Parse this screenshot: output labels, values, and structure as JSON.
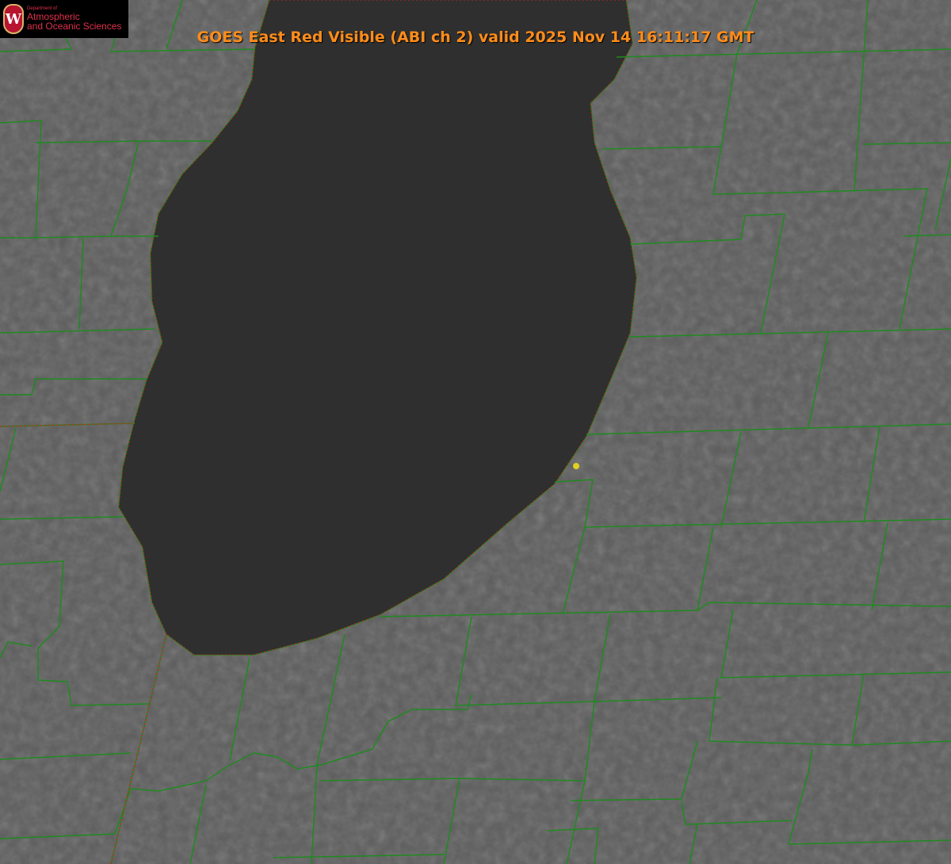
{
  "title": "GOES East Red Visible (ABI ch 2) valid 2025 Nov 14 16:11:17 GMT",
  "logo": {
    "dept": "Department of",
    "line1": "Atmospheric",
    "line2": "and Oceanic Sciences",
    "seal_letter": "W"
  },
  "colors": {
    "title": "#ff8c1a",
    "county_lines": "#1f8a1f",
    "shoreline": "#d02020",
    "marker": "#e0d020",
    "lake": "#2e2e2e",
    "land": "#5a5a5a"
  }
}
